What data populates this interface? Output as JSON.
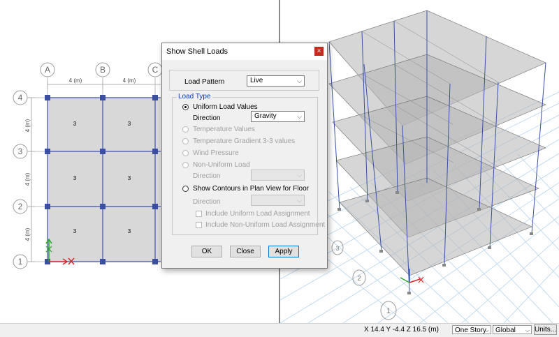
{
  "plan_view": {
    "grid_columns": [
      "A",
      "B",
      "C"
    ],
    "grid_rows": [
      "4",
      "3",
      "2",
      "1"
    ],
    "spacing_x_labels": [
      "4 (m)",
      "4 (m)"
    ],
    "spacing_y_labels": [
      "4 (m)",
      "4 (m)",
      "4 (m)"
    ],
    "shell_values": [
      "3",
      "3",
      "3",
      "3",
      "3",
      "3"
    ]
  },
  "dialog": {
    "title": "Show Shell Loads",
    "close_label": "×",
    "load_pattern_label": "Load Pattern",
    "load_pattern_value": "Live",
    "load_type_group": "Load Type",
    "uniform_label": "Uniform Load Values",
    "direction_label": "Direction",
    "direction_value": "Gravity",
    "temperature_label": "Temperature Values",
    "temperature_gradient_label": "Temperature Gradient 3-3 values",
    "wind_label": "Wind Pressure",
    "nonuniform_label": "Non-Uniform Load",
    "direction2_label": "Direction",
    "contours_label": "Show Contours in Plan View for Floor",
    "direction3_label": "Direction",
    "include_uniform_label": "Include Uniform Load Assignment",
    "include_nonuniform_label": "Include Non-Uniform Load Assignment",
    "ok_label": "OK",
    "close_button_label": "Close",
    "apply_label": "Apply"
  },
  "view3d": {
    "grid_bubbles": [
      "3",
      "2",
      "1"
    ]
  },
  "statusbar": {
    "coordinates": "X 14.4  Y -4.4  Z 16.5 (m)",
    "story_select": "One Story",
    "coord_system": "Global",
    "units_button": "Units..."
  },
  "colors": {
    "frame": "#3a50a8",
    "joint": "#3b4ea0",
    "shell_fill": "#d8d8d8",
    "dialog_accent": "#0a3ca8"
  }
}
